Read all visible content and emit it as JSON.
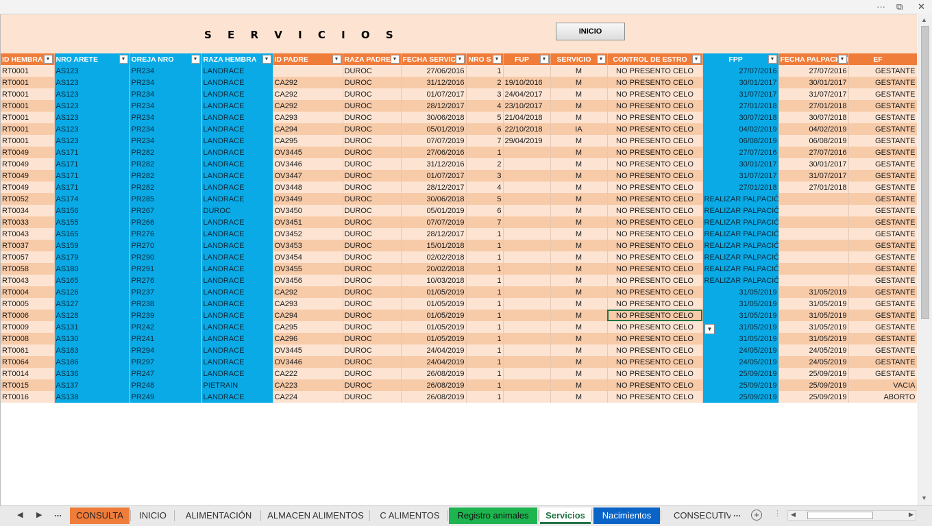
{
  "window": {
    "controls": {
      "more": "···",
      "restore": "⧉",
      "close": "✕"
    }
  },
  "header": {
    "title": "S E R V I C I O S",
    "inicio_button": "INICIO"
  },
  "columns": [
    {
      "label": "ID HEMBRA",
      "color": "orange"
    },
    {
      "label": "NRO ARETE",
      "color": "blue"
    },
    {
      "label": "OREJA NRO",
      "color": "blue"
    },
    {
      "label": "RAZA HEMBRA",
      "color": "blue"
    },
    {
      "label": "ID PADRE",
      "color": "orange"
    },
    {
      "label": "RAZA PADRE",
      "color": "orange"
    },
    {
      "label": "FECHA SERVICIO",
      "color": "orange"
    },
    {
      "label": "NRO S",
      "color": "orange"
    },
    {
      "label": "FUP",
      "color": "orange"
    },
    {
      "label": "SERVICIO",
      "color": "orange"
    },
    {
      "label": "CONTROL DE ESTRO",
      "color": "orange"
    },
    {
      "label": "FPP",
      "color": "blue"
    },
    {
      "label": "FECHA PALPACION",
      "color": "orange"
    },
    {
      "label": "EF",
      "color": "orange"
    }
  ],
  "rows": [
    [
      "RT0001",
      "AS123",
      "PR234",
      "LANDRACE",
      "",
      "DUROC",
      "27/06/2016",
      "1",
      "",
      "M",
      "NO PRESENTO CELO",
      "27/07/2016",
      "27/07/2016",
      "GESTANTE"
    ],
    [
      "RT0001",
      "AS123",
      "PR234",
      "LANDRACE",
      "CA292",
      "DUROC",
      "31/12/2016",
      "2",
      "19/10/2016",
      "M",
      "NO PRESENTO CELO",
      "30/01/2017",
      "30/01/2017",
      "GESTANTE"
    ],
    [
      "RT0001",
      "AS123",
      "PR234",
      "LANDRACE",
      "CA292",
      "DUROC",
      "01/07/2017",
      "3",
      "24/04/2017",
      "M",
      "NO PRESENTO CELO",
      "31/07/2017",
      "31/07/2017",
      "GESTANTE"
    ],
    [
      "RT0001",
      "AS123",
      "PR234",
      "LANDRACE",
      "CA292",
      "DUROC",
      "28/12/2017",
      "4",
      "23/10/2017",
      "M",
      "NO PRESENTO CELO",
      "27/01/2018",
      "27/01/2018",
      "GESTANTE"
    ],
    [
      "RT0001",
      "AS123",
      "PR234",
      "LANDRACE",
      "CA293",
      "DUROC",
      "30/06/2018",
      "5",
      "21/04/2018",
      "M",
      "NO PRESENTO CELO",
      "30/07/2018",
      "30/07/2018",
      "GESTANTE"
    ],
    [
      "RT0001",
      "AS123",
      "PR234",
      "LANDRACE",
      "CA294",
      "DUROC",
      "05/01/2019",
      "6",
      "22/10/2018",
      "IA",
      "NO PRESENTO CELO",
      "04/02/2019",
      "04/02/2019",
      "GESTANTE"
    ],
    [
      "RT0001",
      "AS123",
      "PR234",
      "LANDRACE",
      "CA295",
      "DUROC",
      "07/07/2019",
      "7",
      "29/04/2019",
      "M",
      "NO PRESENTO CELO",
      "06/08/2019",
      "06/08/2019",
      "GESTANTE"
    ],
    [
      "RT0049",
      "AS171",
      "PR282",
      "LANDRACE",
      "OV3445",
      "DUROC",
      "27/06/2016",
      "1",
      "",
      "M",
      "NO PRESENTO CELO",
      "27/07/2016",
      "27/07/2016",
      "GESTANTE"
    ],
    [
      "RT0049",
      "AS171",
      "PR282",
      "LANDRACE",
      "OV3446",
      "DUROC",
      "31/12/2016",
      "2",
      "",
      "M",
      "NO PRESENTO CELO",
      "30/01/2017",
      "30/01/2017",
      "GESTANTE"
    ],
    [
      "RT0049",
      "AS171",
      "PR282",
      "LANDRACE",
      "OV3447",
      "DUROC",
      "01/07/2017",
      "3",
      "",
      "M",
      "NO PRESENTO CELO",
      "31/07/2017",
      "31/07/2017",
      "GESTANTE"
    ],
    [
      "RT0049",
      "AS171",
      "PR282",
      "LANDRACE",
      "OV3448",
      "DUROC",
      "28/12/2017",
      "4",
      "",
      "M",
      "NO PRESENTO CELO",
      "27/01/2018",
      "27/01/2018",
      "GESTANTE"
    ],
    [
      "RT0052",
      "AS174",
      "PR285",
      "LANDRACE",
      "OV3449",
      "DUROC",
      "30/06/2018",
      "5",
      "",
      "M",
      "NO PRESENTO CELO",
      "REALIZAR PALPACIÓN",
      "",
      "GESTANTE"
    ],
    [
      "RT0034",
      "AS156",
      "PR267",
      "DUROC",
      "OV3450",
      "DUROC",
      "05/01/2019",
      "6",
      "",
      "M",
      "NO PRESENTO CELO",
      "REALIZAR PALPACIÓN",
      "",
      "GESTANTE"
    ],
    [
      "RT0033",
      "AS155",
      "PR266",
      "LANDRACE",
      "OV3451",
      "DUROC",
      "07/07/2019",
      "7",
      "",
      "M",
      "NO PRESENTO CELO",
      "REALIZAR PALPACIÓN",
      "",
      "GESTANTE"
    ],
    [
      "RT0043",
      "AS165",
      "PR276",
      "LANDRACE",
      "OV3452",
      "DUROC",
      "28/12/2017",
      "1",
      "",
      "M",
      "NO PRESENTO CELO",
      "REALIZAR PALPACIÓN",
      "",
      "GESTANTE"
    ],
    [
      "RT0037",
      "AS159",
      "PR270",
      "LANDRACE",
      "OV3453",
      "DUROC",
      "15/01/2018",
      "1",
      "",
      "M",
      "NO PRESENTO CELO",
      "REALIZAR PALPACIÓN",
      "",
      "GESTANTE"
    ],
    [
      "RT0057",
      "AS179",
      "PR290",
      "LANDRACE",
      "OV3454",
      "DUROC",
      "02/02/2018",
      "1",
      "",
      "M",
      "NO PRESENTO CELO",
      "REALIZAR PALPACIÓN",
      "",
      "GESTANTE"
    ],
    [
      "RT0058",
      "AS180",
      "PR291",
      "LANDRACE",
      "OV3455",
      "DUROC",
      "20/02/2018",
      "1",
      "",
      "M",
      "NO PRESENTO CELO",
      "REALIZAR PALPACIÓN",
      "",
      "GESTANTE"
    ],
    [
      "RT0043",
      "AS165",
      "PR276",
      "LANDRACE",
      "OV3456",
      "DUROC",
      "10/03/2018",
      "1",
      "",
      "M",
      "NO PRESENTO CELO",
      "REALIZAR PALPACIÓN",
      "",
      "GESTANTE"
    ],
    [
      "RT0004",
      "AS126",
      "PR237",
      "LANDRACE",
      "CA292",
      "DUROC",
      "01/05/2019",
      "1",
      "",
      "M",
      "NO PRESENTO CELO",
      "31/05/2019",
      "31/05/2019",
      "GESTANTE"
    ],
    [
      "RT0005",
      "AS127",
      "PR238",
      "LANDRACE",
      "CA293",
      "DUROC",
      "01/05/2019",
      "1",
      "",
      "M",
      "NO PRESENTO CELO",
      "31/05/2019",
      "31/05/2019",
      "GESTANTE"
    ],
    [
      "RT0006",
      "AS128",
      "PR239",
      "LANDRACE",
      "CA294",
      "DUROC",
      "01/05/2019",
      "1",
      "",
      "M",
      "NO PRESENTO CELO",
      "31/05/2019",
      "31/05/2019",
      "GESTANTE"
    ],
    [
      "RT0009",
      "AS131",
      "PR242",
      "LANDRACE",
      "CA295",
      "DUROC",
      "01/05/2019",
      "1",
      "",
      "M",
      "NO PRESENTO CELO",
      "31/05/2019",
      "31/05/2019",
      "GESTANTE"
    ],
    [
      "RT0008",
      "AS130",
      "PR241",
      "LANDRACE",
      "CA296",
      "DUROC",
      "01/05/2019",
      "1",
      "",
      "M",
      "NO PRESENTO CELO",
      "31/05/2019",
      "31/05/2019",
      "GESTANTE"
    ],
    [
      "RT0061",
      "AS183",
      "PR294",
      "LANDRACE",
      "OV3445",
      "DUROC",
      "24/04/2019",
      "1",
      "",
      "M",
      "NO PRESENTO CELO",
      "24/05/2019",
      "24/05/2019",
      "GESTANTE"
    ],
    [
      "RT0064",
      "AS186",
      "PR297",
      "LANDRACE",
      "OV3446",
      "DUROC",
      "24/04/2019",
      "1",
      "",
      "M",
      "NO PRESENTO CELO",
      "24/05/2019",
      "24/05/2019",
      "GESTANTE"
    ],
    [
      "RT0014",
      "AS136",
      "PR247",
      "LANDRACE",
      "CA222",
      "DUROC",
      "26/08/2019",
      "1",
      "",
      "M",
      "NO PRESENTO CELO",
      "25/09/2019",
      "25/09/2019",
      "GESTANTE"
    ],
    [
      "RT0015",
      "AS137",
      "PR248",
      "PIETRAIN",
      "CA223",
      "DUROC",
      "26/08/2019",
      "1",
      "",
      "M",
      "NO PRESENTO CELO",
      "25/09/2019",
      "25/09/2019",
      "VACIA"
    ],
    [
      "RT0016",
      "AS138",
      "PR249",
      "LANDRACE",
      "CA224",
      "DUROC",
      "26/08/2019",
      "1",
      "",
      "M",
      "NO PRESENTO CELO",
      "25/09/2019",
      "25/09/2019",
      "ABORTO"
    ]
  ],
  "selected_cell": {
    "row": 21,
    "col": 10
  },
  "tabs": {
    "nav_prev": "◀",
    "nav_next": "▶",
    "more_left": "...",
    "items": [
      {
        "label": "CONSULTA",
        "style": "consulta"
      },
      {
        "label": "INICIO",
        "style": "plain"
      },
      {
        "label": "ALIMENTACIÓN",
        "style": "plain"
      },
      {
        "label": "ALMACEN ALIMENTOS",
        "style": "plain"
      },
      {
        "label": "C ALIMENTOS",
        "style": "plain"
      },
      {
        "label": "Registro animales",
        "style": "registro"
      },
      {
        "label": "Servicios",
        "style": "servicios"
      },
      {
        "label": "Nacimientos",
        "style": "nacimientos"
      },
      {
        "label": "CONSECUTIVO",
        "style": "plain"
      }
    ],
    "more_right": "...",
    "add_sheet": "+"
  },
  "colors": {
    "orange_header": "#f07c3a",
    "blue_column": "#0aaae6",
    "row_light": "#fde4d2",
    "row_dark": "#f7caa8",
    "active_tab": "#217346"
  }
}
